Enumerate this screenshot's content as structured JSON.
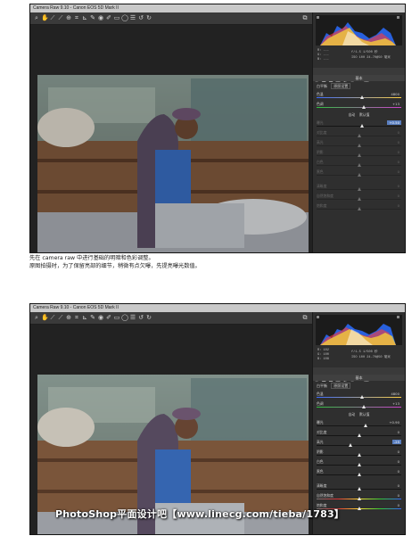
{
  "window1": {
    "title": "Camera Raw 9.10 - Canon EOS 5D Mark II",
    "readout_left": [
      "R: ---",
      "G: ---",
      "B: ---"
    ],
    "readout_right": [
      "f/1.5  1/500 秒",
      "ISO 100  24-70@50 毫米"
    ],
    "section_title": "基本",
    "wb_label": "白平衡",
    "wb_value": "原照设置",
    "sliders": [
      {
        "label": "色温",
        "value": "4800"
      },
      {
        "label": "色调",
        "value": "+13"
      }
    ],
    "auto_labels": [
      "自动",
      "默认值"
    ],
    "basic_sliders": [
      {
        "label": "曝光",
        "value": "+0.50"
      },
      {
        "label": "对比度",
        "value": "0"
      },
      {
        "label": "高光",
        "value": "0"
      },
      {
        "label": "阴影",
        "value": "0"
      },
      {
        "label": "白色",
        "value": "0"
      },
      {
        "label": "黑色",
        "value": "0"
      },
      {
        "label": "清晰度",
        "value": "0"
      },
      {
        "label": "自然饱和度",
        "value": "0"
      },
      {
        "label": "饱和度",
        "value": "0"
      }
    ]
  },
  "caption": {
    "line1": "先在 camera raw 中进行基础的明暗和色彩调整。",
    "line2": "原图拍摄时，为了保留亮部的细节，稍微有点欠曝，先提亮曝光数值。"
  },
  "window2": {
    "title": "Camera Raw 9.10 - Canon EOS 5D Mark II",
    "readout_left": [
      "R: 102",
      "G: 100",
      "B: 108"
    ],
    "readout_right": [
      "f/1.5  1/500 秒",
      "ISO 100  24-70@50 毫米"
    ],
    "section_title": "基本",
    "wb_label": "白平衡",
    "wb_value": "原照设置",
    "sliders": [
      {
        "label": "色温",
        "value": "4800"
      },
      {
        "label": "色调",
        "value": "+13"
      }
    ],
    "auto_labels": [
      "自动",
      "默认值"
    ],
    "basic_sliders": [
      {
        "label": "曝光",
        "value": "+0.90"
      },
      {
        "label": "对比度",
        "value": "0"
      },
      {
        "label": "高光",
        "value": "-25"
      },
      {
        "label": "阴影",
        "value": "0"
      },
      {
        "label": "白色",
        "value": "0"
      },
      {
        "label": "黑色",
        "value": "0"
      },
      {
        "label": "清晰度",
        "value": "0"
      },
      {
        "label": "自然饱和度",
        "value": "0"
      },
      {
        "label": "饱和度",
        "value": "0"
      }
    ]
  },
  "watermark": "PhotoShop平面设计吧【www.linecg.com/tieba/1783】",
  "colors": {
    "accent": "#5a7fc0",
    "panel": "#2f2f2f"
  }
}
